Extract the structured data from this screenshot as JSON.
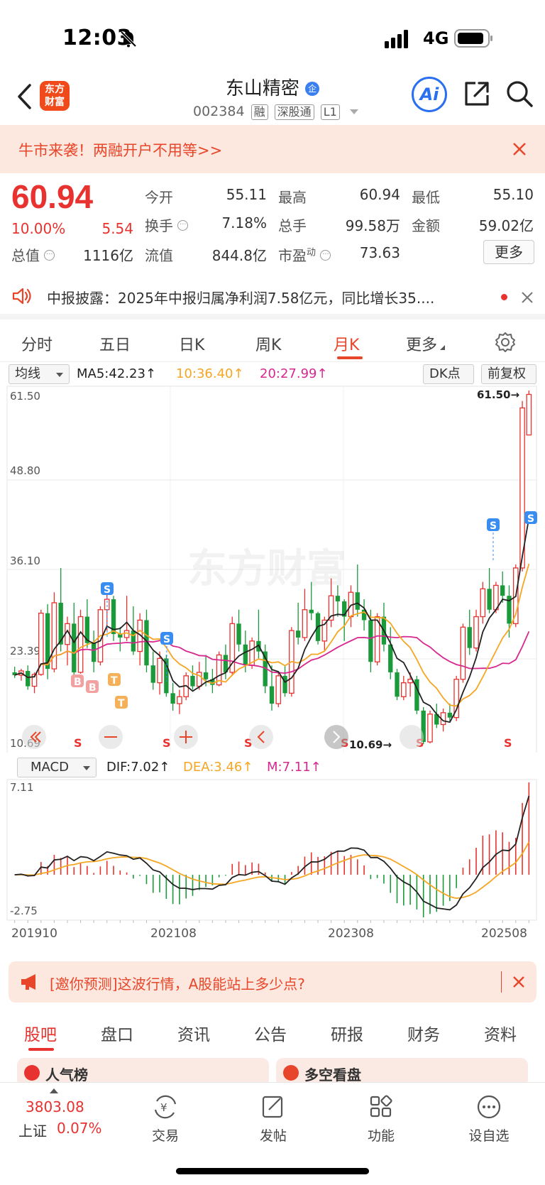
{
  "status_bar": {
    "time": "12:03",
    "network": "4G"
  },
  "header": {
    "logo_line1": "东方",
    "logo_line2": "财富",
    "stock_name": "东山精密",
    "name_badge": "企",
    "stock_code": "002384",
    "tags": [
      "融",
      "深股通",
      "L1"
    ],
    "ai_label": "Ai"
  },
  "promo": {
    "text": "牛市来袭！两融开户不用等>>"
  },
  "quote": {
    "price": "60.94",
    "change_pct": "10.00%",
    "change": "5.54",
    "fields": [
      {
        "label": "今开",
        "value": "55.11",
        "color": "green"
      },
      {
        "label": "最高",
        "value": "60.94",
        "color": "red"
      },
      {
        "label": "最低",
        "value": "55.10",
        "color": "green"
      },
      {
        "label": "换手",
        "value": "7.18%",
        "color": "normal"
      },
      {
        "label": "总手",
        "value": "99.58万",
        "color": "normal"
      },
      {
        "label": "金额",
        "value": "59.02亿",
        "color": "normal"
      },
      {
        "label": "总值",
        "value": "1116亿",
        "color": "normal"
      },
      {
        "label": "流值",
        "value": "844.8亿",
        "color": "normal"
      },
      {
        "label": "市盈",
        "value": "73.63",
        "color": "normal"
      }
    ],
    "pe_superscript": "动",
    "more_label": "更多"
  },
  "notice": {
    "text": "中报披露：2025年中报归属净利润7.58亿元，同比增长35...."
  },
  "chart_tabs": [
    {
      "label": "分时"
    },
    {
      "label": "五日"
    },
    {
      "label": "日K"
    },
    {
      "label": "周K"
    },
    {
      "label": "月K"
    },
    {
      "label": "更多"
    }
  ],
  "ma_row": {
    "selector": "均线",
    "ma5": "MA5:42.23↑",
    "ma10": "10:36.40↑",
    "ma20": "20:27.99↑",
    "dk": "DK点",
    "adjust": "前复权"
  },
  "colors": {
    "up": "#e8322f",
    "down": "#1a9a3a",
    "ma5": "#222222",
    "ma10": "#f5a623",
    "ma20": "#d6288f",
    "accent": "#e8462a"
  },
  "kline_markers": {
    "max_label": "61.50→",
    "min_label": "10.69→",
    "watermark": "东方财富"
  },
  "macd_row": {
    "selector": "MACD",
    "dif": "DIF:7.02↑",
    "dea": "DEA:3.46↑",
    "m": "M:7.11↑"
  },
  "poll": {
    "text": "[邀你预测]这波行情，A股能站上多少点?"
  },
  "bottom_tabs": [
    {
      "label": "股吧"
    },
    {
      "label": "盘口"
    },
    {
      "label": "资讯"
    },
    {
      "label": "公告"
    },
    {
      "label": "研报"
    },
    {
      "label": "财务"
    },
    {
      "label": "资料"
    }
  ],
  "peek": {
    "left": "人气榜",
    "right": "多空看盘"
  },
  "bottom_nav": {
    "index_value": "3803.08",
    "index_name": "上证",
    "index_pct": "0.07%",
    "items": [
      {
        "label": "交易"
      },
      {
        "label": "发帖"
      },
      {
        "label": "功能"
      },
      {
        "label": "设自选"
      }
    ]
  },
  "chart_data": [
    {
      "type": "candlestick",
      "title": "",
      "y_ticks": [
        "61.50",
        "48.80",
        "36.10",
        "23.39",
        "10.69"
      ],
      "ylim": [
        10.69,
        61.5
      ],
      "x_ticks": [
        "201910",
        "202108",
        "202308",
        "202508"
      ],
      "series": [
        {
          "name": "MA5",
          "last": 42.23
        },
        {
          "name": "10",
          "last": 36.4
        },
        {
          "name": "20",
          "last": 27.99
        }
      ],
      "ohlc_monthly": [
        [
          21.0,
          21.8,
          20.2,
          20.6
        ],
        [
          20.6,
          21.5,
          19.8,
          21.2
        ],
        [
          21.2,
          22.0,
          18.5,
          19.0
        ],
        [
          19.0,
          21.0,
          18.0,
          20.7
        ],
        [
          20.7,
          30.0,
          20.5,
          29.5
        ],
        [
          29.5,
          30.8,
          20.0,
          21.5
        ],
        [
          21.5,
          32.5,
          21.0,
          31.0
        ],
        [
          31.0,
          36.0,
          24.0,
          25.0
        ],
        [
          25.0,
          29.0,
          22.0,
          28.0
        ],
        [
          28.0,
          31.0,
          20.5,
          21.0
        ],
        [
          21.0,
          30.0,
          20.8,
          29.0
        ],
        [
          29.0,
          31.5,
          24.5,
          25.2
        ],
        [
          25.2,
          27.0,
          21.0,
          22.5
        ],
        [
          22.5,
          30.5,
          22.0,
          30.0
        ],
        [
          30.0,
          33.5,
          27.0,
          31.5
        ],
        [
          31.5,
          32.0,
          25.5,
          26.5
        ],
        [
          26.5,
          27.5,
          24.0,
          26.0
        ],
        [
          26.0,
          32.0,
          25.5,
          27.0
        ],
        [
          27.0,
          30.5,
          23.5,
          24.0
        ],
        [
          24.0,
          29.5,
          22.0,
          28.5
        ],
        [
          28.5,
          30.0,
          21.0,
          22.0
        ],
        [
          22.0,
          24.0,
          18.5,
          19.5
        ],
        [
          19.5,
          24.0,
          17.8,
          23.0
        ],
        [
          23.0,
          23.5,
          17.5,
          18.0
        ],
        [
          18.0,
          19.5,
          15.5,
          16.5
        ],
        [
          16.5,
          18.5,
          15.0,
          17.5
        ],
        [
          17.5,
          21.0,
          17.0,
          20.5
        ],
        [
          20.5,
          22.0,
          18.5,
          19.0
        ],
        [
          19.0,
          22.5,
          18.5,
          21.0
        ],
        [
          21.0,
          23.5,
          19.0,
          20.0
        ],
        [
          20.0,
          21.5,
          18.0,
          19.2
        ],
        [
          19.2,
          24.0,
          19.0,
          23.5
        ],
        [
          23.5,
          25.0,
          20.0,
          21.0
        ],
        [
          21.0,
          29.0,
          20.5,
          28.0
        ],
        [
          28.0,
          30.0,
          24.0,
          25.0
        ],
        [
          25.0,
          27.0,
          21.0,
          22.0
        ],
        [
          22.0,
          26.0,
          21.5,
          25.5
        ],
        [
          25.5,
          30.0,
          23.0,
          24.0
        ],
        [
          24.0,
          25.0,
          18.0,
          19.0
        ],
        [
          19.0,
          22.0,
          15.5,
          16.5
        ],
        [
          16.5,
          21.0,
          16.0,
          20.5
        ],
        [
          20.5,
          22.0,
          17.5,
          18.0
        ],
        [
          18.0,
          27.5,
          17.5,
          27.0
        ],
        [
          27.0,
          31.0,
          25.0,
          26.0
        ],
        [
          26.0,
          33.0,
          25.5,
          30.0
        ],
        [
          30.0,
          34.0,
          28.5,
          29.5
        ],
        [
          29.5,
          29.7,
          25.0,
          25.5
        ],
        [
          25.5,
          29.0,
          24.0,
          28.5
        ],
        [
          28.5,
          34.5,
          27.5,
          32.0
        ],
        [
          32.0,
          33.5,
          29.0,
          31.2
        ],
        [
          31.2,
          31.5,
          25.5,
          29.0
        ],
        [
          29.0,
          33.5,
          27.5,
          32.5
        ],
        [
          32.5,
          36.5,
          29.0,
          30.0
        ],
        [
          30.0,
          31.5,
          27.0,
          28.5
        ],
        [
          28.5,
          30.0,
          21.0,
          22.5
        ],
        [
          22.5,
          29.5,
          22.0,
          29.0
        ],
        [
          29.0,
          31.0,
          24.0,
          25.0
        ],
        [
          25.0,
          27.5,
          20.0,
          21.0
        ],
        [
          21.0,
          21.5,
          17.0,
          17.5
        ],
        [
          17.5,
          20.5,
          17.0,
          19.5
        ],
        [
          19.5,
          21.0,
          17.5,
          20.0
        ],
        [
          20.0,
          20.5,
          15.0,
          15.5
        ],
        [
          15.5,
          16.0,
          10.69,
          11.0
        ],
        [
          11.0,
          15.5,
          10.8,
          15.0
        ],
        [
          15.0,
          16.5,
          13.0,
          13.5
        ],
        [
          13.5,
          15.8,
          12.5,
          15.2
        ],
        [
          15.2,
          16.5,
          14.0,
          14.5
        ],
        [
          14.5,
          20.5,
          14.0,
          20.0
        ],
        [
          20.0,
          28.0,
          19.5,
          27.5
        ],
        [
          27.5,
          30.0,
          23.5,
          24.5
        ],
        [
          24.5,
          30.0,
          24.0,
          29.0
        ],
        [
          29.0,
          34.0,
          28.0,
          33.0
        ],
        [
          33.0,
          36.0,
          29.5,
          30.0
        ],
        [
          30.0,
          34.0,
          29.5,
          33.5
        ],
        [
          33.5,
          35.5,
          31.0,
          32.0
        ],
        [
          32.0,
          33.5,
          26.0,
          28.0
        ],
        [
          28.0,
          36.5,
          27.5,
          36.0
        ],
        [
          36.0,
          60.0,
          35.5,
          59.0
        ],
        [
          55.11,
          61.5,
          55.1,
          60.94
        ]
      ]
    },
    {
      "type": "bar",
      "title": "MACD",
      "y_ticks": [
        "7.11",
        "-2.75"
      ],
      "ylim": [
        -2.75,
        7.11
      ],
      "series": [
        {
          "name": "DIF",
          "last": 7.02
        },
        {
          "name": "DEA",
          "last": 3.46
        },
        {
          "name": "M",
          "last": 7.11
        }
      ]
    }
  ]
}
